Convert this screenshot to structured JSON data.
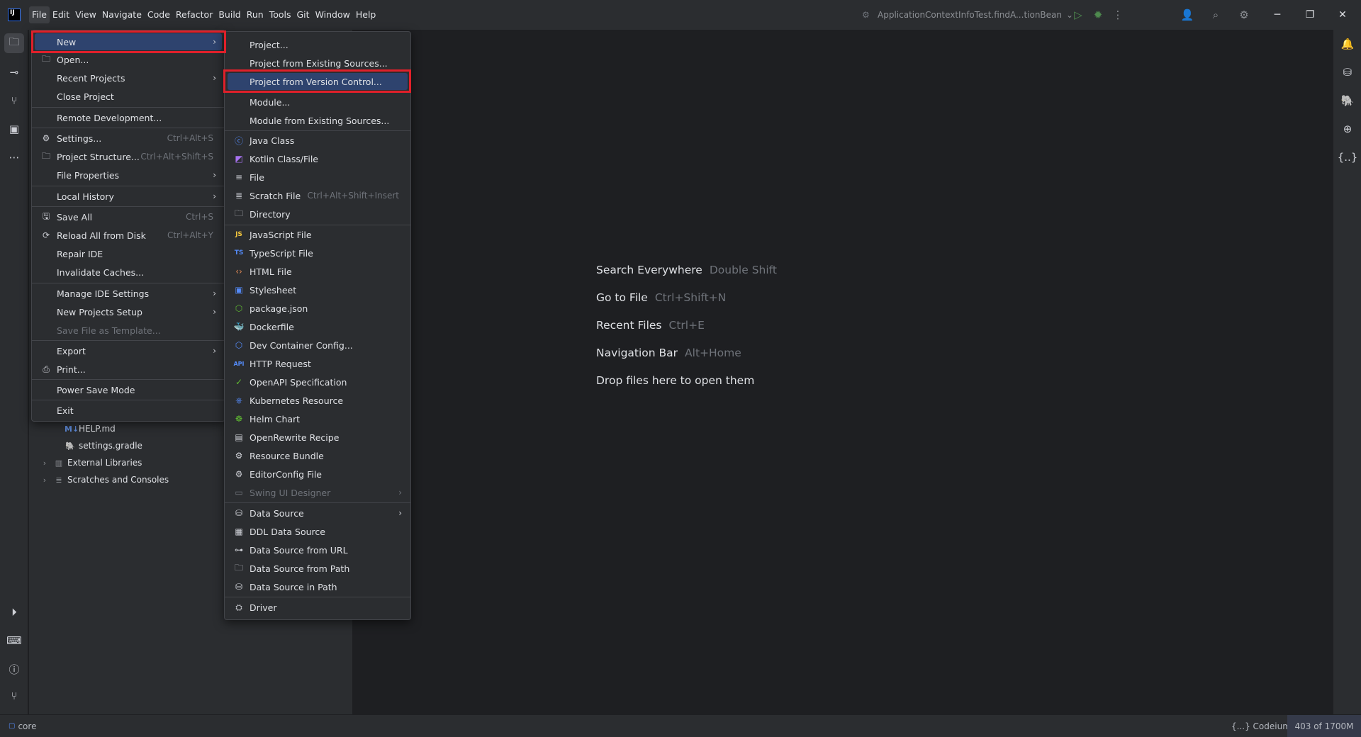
{
  "app": {
    "logo_text": "IJ",
    "menubar": [
      "File",
      "Edit",
      "View",
      "Navigate",
      "Code",
      "Refactor",
      "Build",
      "Run",
      "Tools",
      "Git",
      "Window",
      "Help"
    ],
    "run_config": "ApplicationContextInfoTest.findA...tionBean"
  },
  "file_menu": {
    "items": [
      {
        "label": "New",
        "shortcut": "",
        "submenu": true,
        "selected": true,
        "icon": ""
      },
      {
        "label": "Open...",
        "shortcut": "",
        "icon": "folder-icon"
      },
      {
        "label": "Recent Projects",
        "submenu": true
      },
      {
        "label": "Close Project"
      },
      {
        "label": "Remote Development..."
      },
      {
        "label": "Settings...",
        "shortcut": "Ctrl+Alt+S",
        "icon": "gear-icon"
      },
      {
        "label": "Project Structure...",
        "shortcut": "Ctrl+Alt+Shift+S",
        "icon": "project-structure-icon"
      },
      {
        "label": "File Properties",
        "submenu": true
      },
      {
        "label": "Local History",
        "submenu": true
      },
      {
        "label": "Save All",
        "shortcut": "Ctrl+S",
        "icon": "save-icon"
      },
      {
        "label": "Reload All from Disk",
        "shortcut": "Ctrl+Alt+Y",
        "icon": "reload-icon"
      },
      {
        "label": "Repair IDE"
      },
      {
        "label": "Invalidate Caches..."
      },
      {
        "label": "Manage IDE Settings",
        "submenu": true
      },
      {
        "label": "New Projects Setup",
        "submenu": true
      },
      {
        "label": "Save File as Template...",
        "disabled": true
      },
      {
        "label": "Export",
        "submenu": true
      },
      {
        "label": "Print...",
        "icon": "print-icon"
      },
      {
        "label": "Power Save Mode"
      },
      {
        "label": "Exit"
      }
    ]
  },
  "new_submenu": {
    "items": [
      {
        "label": "Project..."
      },
      {
        "label": "Project from Existing Sources..."
      },
      {
        "label": "Project from Version Control...",
        "selected": true
      },
      {
        "label": "Module..."
      },
      {
        "label": "Module from Existing Sources..."
      },
      {
        "label": "Java Class",
        "icon": "java-class-icon"
      },
      {
        "label": "Kotlin Class/File",
        "icon": "kotlin-icon"
      },
      {
        "label": "File",
        "icon": "file-icon"
      },
      {
        "label": "Scratch File",
        "shortcut": "Ctrl+Alt+Shift+Insert",
        "icon": "scratch-file-icon"
      },
      {
        "label": "Directory",
        "icon": "folder-icon"
      },
      {
        "label": "JavaScript File",
        "icon": "javascript-icon"
      },
      {
        "label": "TypeScript File",
        "icon": "typescript-icon"
      },
      {
        "label": "HTML File",
        "icon": "html-icon"
      },
      {
        "label": "Stylesheet",
        "icon": "css-icon"
      },
      {
        "label": "package.json",
        "icon": "nodejs-icon"
      },
      {
        "label": "Dockerfile",
        "icon": "docker-icon"
      },
      {
        "label": "Dev Container Config...",
        "icon": "dev-container-icon"
      },
      {
        "label": "HTTP Request",
        "icon": "api-icon"
      },
      {
        "label": "OpenAPI Specification",
        "icon": "openapi-icon"
      },
      {
        "label": "Kubernetes Resource",
        "icon": "kubernetes-icon"
      },
      {
        "label": "Helm Chart",
        "icon": "helm-icon"
      },
      {
        "label": "OpenRewrite Recipe",
        "icon": "openrewrite-icon"
      },
      {
        "label": "Resource Bundle",
        "icon": "resource-bundle-icon"
      },
      {
        "label": "EditorConfig File",
        "icon": "editorconfig-icon"
      },
      {
        "label": "Swing UI Designer",
        "disabled": true,
        "submenu": true,
        "icon": "swing-icon"
      },
      {
        "label": "Data Source",
        "submenu": true,
        "icon": "database-icon"
      },
      {
        "label": "DDL Data Source",
        "icon": "ddl-icon"
      },
      {
        "label": "Data Source from URL",
        "icon": "url-icon"
      },
      {
        "label": "Data Source from Path",
        "icon": "folder-icon"
      },
      {
        "label": "Data Source in Path",
        "icon": "database-icon"
      },
      {
        "label": "Driver",
        "icon": "driver-icon"
      }
    ]
  },
  "project_tree": [
    {
      "label": "HELP.md",
      "icon": "markdown-icon"
    },
    {
      "label": "settings.gradle",
      "icon": "gradle-icon"
    },
    {
      "label": "External Libraries",
      "icon": "library-icon"
    },
    {
      "label": "Scratches and Consoles",
      "icon": "scratches-icon"
    }
  ],
  "editor_hints": [
    {
      "action": "Search Everywhere",
      "key": "Double Shift"
    },
    {
      "action": "Go to File",
      "key": "Ctrl+Shift+N"
    },
    {
      "action": "Recent Files",
      "key": "Ctrl+E"
    },
    {
      "action": "Navigation Bar",
      "key": "Alt+Home"
    },
    {
      "action": "Drop files here to open them",
      "key": ""
    }
  ],
  "status": {
    "project": "core",
    "plugin": "{...} Codeium",
    "memory": "403 of 1700M"
  },
  "colors": {
    "accent": "#3574f0",
    "selection": "#2e436e",
    "highlight_box": "#e0202a"
  }
}
